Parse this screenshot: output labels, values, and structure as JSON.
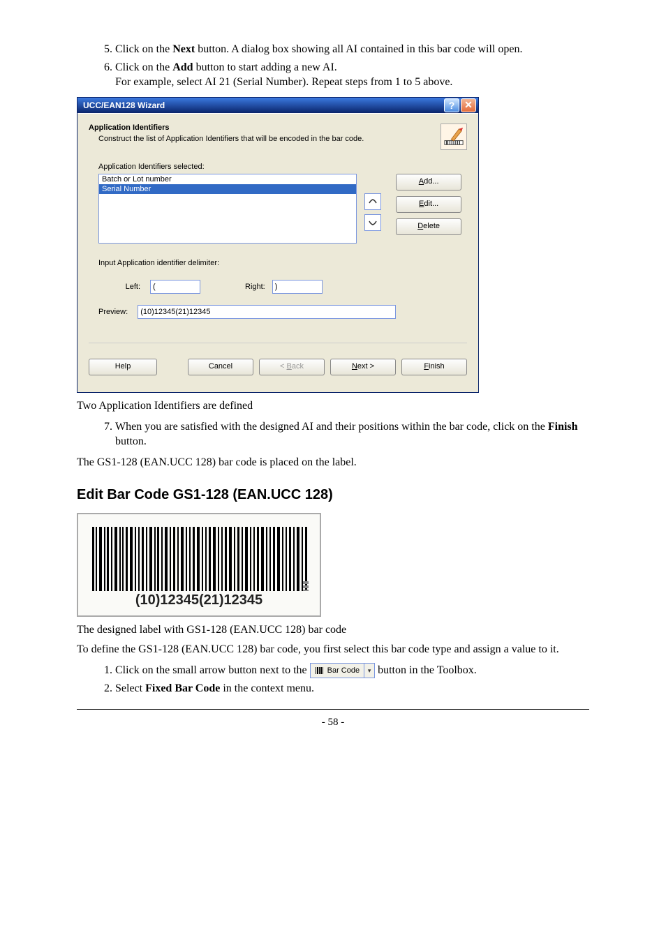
{
  "steps_a": [
    {
      "num": "5.",
      "pre": "Click on the ",
      "bold": "Next",
      "post": " button. A dialog box showing all AI contained in this bar code will open."
    },
    {
      "num": "6.",
      "pre": "Click on the ",
      "bold": "Add",
      "post": " button to start adding a new AI.",
      "extra": "For example, select AI 21 (Serial Number). Repeat steps from 1 to 5 above."
    }
  ],
  "dialog": {
    "title": "UCC/EAN128 Wizard",
    "header_title": "Application Identifiers",
    "header_sub": "Construct the list of Application Identifiers that will be encoded in the bar code.",
    "list_label": "Application Identifiers selected:",
    "items": [
      {
        "text": "Batch or Lot number",
        "selected": false
      },
      {
        "text": "Serial Number",
        "selected": true
      }
    ],
    "btn_add": "Add...",
    "btn_edit": "Edit...",
    "btn_delete": "Delete",
    "delim_label": "Input Application identifier delimiter:",
    "left_label": "Left:",
    "left_value": "(",
    "right_label": "Right:",
    "right_value": ")",
    "preview_label": "Preview:",
    "preview_value": "(10)12345(21)12345",
    "btn_help": "Help",
    "btn_cancel": "Cancel",
    "btn_back": "< Back",
    "btn_next": "Next >",
    "btn_finish": "Finish"
  },
  "caption1": "Two Application Identifiers are defined",
  "steps_b": [
    {
      "num": "7.",
      "pre": "When you are satisfied with the designed AI and their positions within the bar code, click on the ",
      "bold": "Finish",
      "post": " button."
    }
  ],
  "after7": "The GS1-128 (EAN.UCC 128) bar code is placed on the label.",
  "section_title": "Edit Bar Code GS1-128 (EAN.UCC 128)",
  "barcode_text": "(10)12345(21)12345",
  "caption2": "The designed label with GS1-128 (EAN.UCC 128) bar code",
  "para3": "To define the GS1-128 (EAN.UCC 128) bar code, you first select this bar code type and assign a value to it.",
  "steps_c": [
    {
      "num": "1.",
      "pre": "Click on the small arrow button next to the ",
      "btn_label": "Bar Code",
      "post": " button in the Toolbox."
    },
    {
      "num": "2.",
      "pre": "Select ",
      "bold": "Fixed Bar Code",
      "post": " in the context menu."
    }
  ],
  "page_num": "- 58 -"
}
